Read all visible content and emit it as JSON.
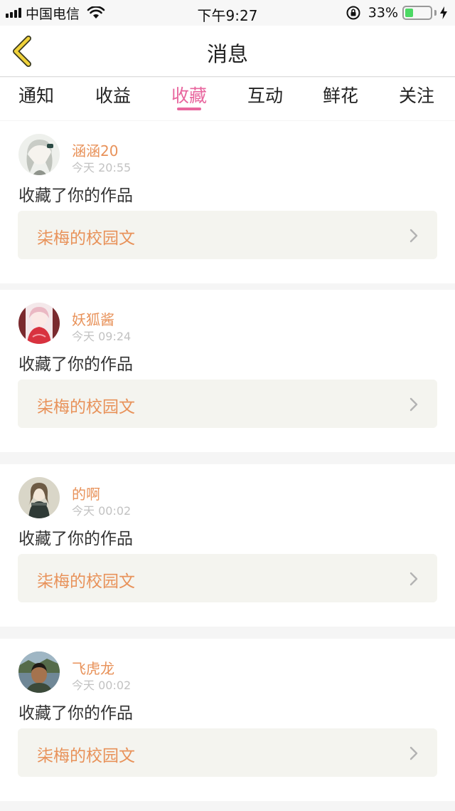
{
  "status_bar": {
    "carrier": "中国电信",
    "time": "下午9:27",
    "battery_percent": "33%",
    "battery_level": 0.33,
    "icons": [
      "signal-icon",
      "wifi-icon",
      "orientation-lock-icon",
      "battery-icon",
      "charging-icon"
    ]
  },
  "nav": {
    "title": "消息",
    "back_icon": "back-chevron-icon"
  },
  "tabs": [
    {
      "label": "通知",
      "active": false
    },
    {
      "label": "收益",
      "active": false
    },
    {
      "label": "收藏",
      "active": true
    },
    {
      "label": "互动",
      "active": false
    },
    {
      "label": "鲜花",
      "active": false
    },
    {
      "label": "关注",
      "active": false
    }
  ],
  "colors": {
    "accent_pink": "#e8669e",
    "username_orange": "#e8925a",
    "work_bg": "#f4f4ef"
  },
  "messages": [
    {
      "user": "涵涵20",
      "time": "今天 20:55",
      "action": "收藏了你的作品",
      "work": "柒梅的校园文"
    },
    {
      "user": "妖狐酱",
      "time": "今天 09:24",
      "action": "收藏了你的作品",
      "work": "柒梅的校园文"
    },
    {
      "user": "的啊",
      "time": "今天 00:02",
      "action": "收藏了你的作品",
      "work": "柒梅的校园文"
    },
    {
      "user": "飞虎龙",
      "time": "今天 00:02",
      "action": "收藏了你的作品",
      "work": "柒梅的校园文"
    }
  ]
}
